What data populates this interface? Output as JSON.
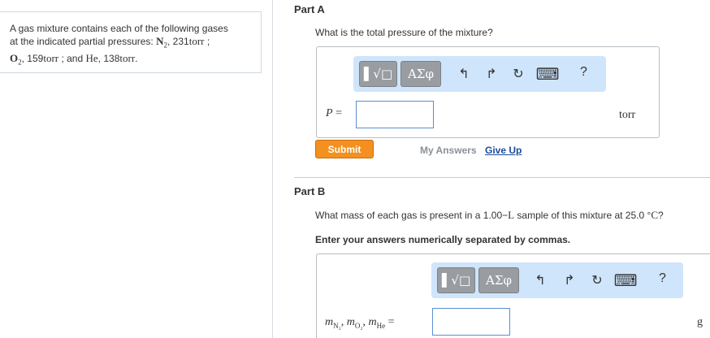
{
  "problem": {
    "text_line1": "A gas mixture contains each of the following gases",
    "text_line2_prefix": "at the indicated partial pressures:",
    "n2_symbol": "N",
    "n2_sub": "2",
    "n2_value": ", 231",
    "unit_torr": "torr",
    "sep1": ";",
    "o2_symbol": "O",
    "o2_sub": "2",
    "o2_value": ", 159",
    "sep2": ";  and",
    "he_symbol": "He",
    "he_value": ", 138",
    "end": "."
  },
  "part_a": {
    "title": "Part A",
    "question": "What is the total pressure of the mixture?",
    "toolbar": {
      "template_label": "▌√□",
      "greek_label": "ΑΣφ",
      "undo_icon": "↰",
      "redo_icon": "↱",
      "reset_icon": "↻",
      "keyboard_icon": "⌨",
      "help_label": "?"
    },
    "variable": "P",
    "equals": "=",
    "input_value": "",
    "unit": "torr",
    "submit_label": "Submit",
    "my_answers_label": "My Answers",
    "give_up_label": "Give Up"
  },
  "part_b": {
    "title": "Part B",
    "question_prefix": "What mass of each gas is present in a 1.00−",
    "question_unit_l": "L",
    "question_mid": " sample of this mixture at 25.0 °",
    "question_unit_c": "C",
    "question_end": "?",
    "instruction": "Enter your answers numerically separated by commas.",
    "toolbar": {
      "template_label": "▌√□",
      "greek_label": "ΑΣφ",
      "undo_icon": "↰",
      "redo_icon": "↱",
      "reset_icon": "↻",
      "keyboard_icon": "⌨",
      "help_label": "?"
    },
    "var_m": "m",
    "sub_n2": "N₂",
    "sub_o2": "O₂",
    "sub_he": "He",
    "comma": ",",
    "equals": "=",
    "input_value": "",
    "unit": "g"
  },
  "colors": {
    "accent_orange": "#f3901f",
    "toolbar_blue": "#cfe5fb",
    "link_blue": "#1a4c9c",
    "input_border": "#5a8fd1"
  }
}
